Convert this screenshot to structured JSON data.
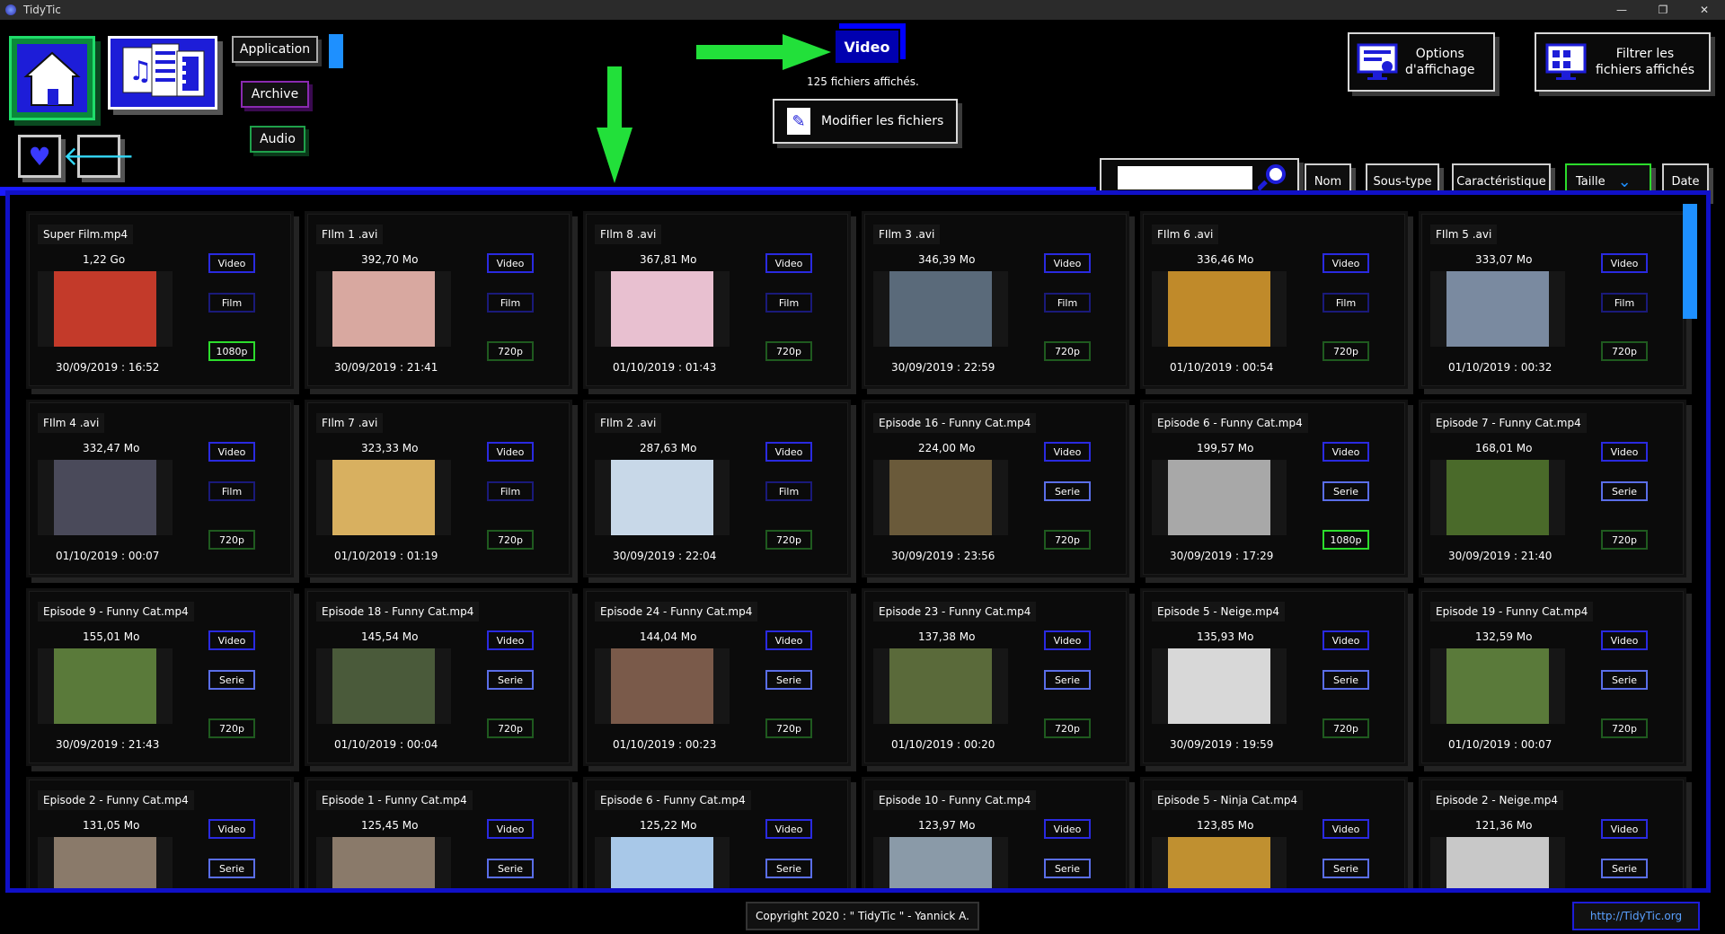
{
  "window": {
    "title": "TidyTic",
    "minimize": "—",
    "restore": "❐",
    "close": "✕"
  },
  "nav": {
    "application": "Application",
    "archive": "Archive",
    "audio": "Audio"
  },
  "header": {
    "category": "Video",
    "count_text": "125 fichiers affichés.",
    "modify_label": "Modifier les fichiers",
    "options_label_1": "Options",
    "options_label_2": "d'affichage",
    "filter_label_1": "Filtrer les",
    "filter_label_2": "fichiers affichés"
  },
  "search": {
    "value": "",
    "placeholder": ""
  },
  "sort": {
    "nom": "Nom",
    "soustype": "Sous-type",
    "caracteristique": "Caractéristique",
    "taille": "Taille",
    "date": "Date"
  },
  "files": [
    {
      "name": "Super Film.mp4",
      "size": "1,22 Go",
      "type": "Video",
      "sub": "Film",
      "res": "1080p",
      "date": "30/09/2019 : 16:52"
    },
    {
      "name": "FIlm 1 .avi",
      "size": "392,70 Mo",
      "type": "Video",
      "sub": "Film",
      "res": "720p",
      "date": "30/09/2019 : 21:41"
    },
    {
      "name": "FIlm 8 .avi",
      "size": "367,81 Mo",
      "type": "Video",
      "sub": "Film",
      "res": "720p",
      "date": "01/10/2019 : 01:43"
    },
    {
      "name": "FIlm 3 .avi",
      "size": "346,39 Mo",
      "type": "Video",
      "sub": "Film",
      "res": "720p",
      "date": "30/09/2019 : 22:59"
    },
    {
      "name": "FIlm 6 .avi",
      "size": "336,46 Mo",
      "type": "Video",
      "sub": "Film",
      "res": "720p",
      "date": "01/10/2019 : 00:54"
    },
    {
      "name": "FIlm 5 .avi",
      "size": "333,07 Mo",
      "type": "Video",
      "sub": "Film",
      "res": "720p",
      "date": "01/10/2019 : 00:32"
    },
    {
      "name": "FIlm 4 .avi",
      "size": "332,47 Mo",
      "type": "Video",
      "sub": "Film",
      "res": "720p",
      "date": "01/10/2019 : 00:07"
    },
    {
      "name": "FIlm 7 .avi",
      "size": "323,33 Mo",
      "type": "Video",
      "sub": "Film",
      "res": "720p",
      "date": "01/10/2019 : 01:19"
    },
    {
      "name": "FIlm 2 .avi",
      "size": "287,63 Mo",
      "type": "Video",
      "sub": "Film",
      "res": "720p",
      "date": "30/09/2019 : 22:04"
    },
    {
      "name": "Episode 16 - Funny Cat.mp4",
      "size": "224,00 Mo",
      "type": "Video",
      "sub": "Serie",
      "res": "720p",
      "date": "30/09/2019 : 23:56"
    },
    {
      "name": "Episode 6 - Funny Cat.mp4",
      "size": "199,57 Mo",
      "type": "Video",
      "sub": "Serie",
      "res": "1080p",
      "date": "30/09/2019 : 17:29"
    },
    {
      "name": "Episode 7 - Funny Cat.mp4",
      "size": "168,01 Mo",
      "type": "Video",
      "sub": "Serie",
      "res": "720p",
      "date": "30/09/2019 : 21:40"
    },
    {
      "name": "Episode 9 - Funny Cat.mp4",
      "size": "155,01 Mo",
      "type": "Video",
      "sub": "Serie",
      "res": "720p",
      "date": "30/09/2019 : 21:43"
    },
    {
      "name": "Episode 18 - Funny Cat.mp4",
      "size": "145,54 Mo",
      "type": "Video",
      "sub": "Serie",
      "res": "720p",
      "date": "01/10/2019 : 00:04"
    },
    {
      "name": "Episode 24 - Funny Cat.mp4",
      "size": "144,04 Mo",
      "type": "Video",
      "sub": "Serie",
      "res": "720p",
      "date": "01/10/2019 : 00:23"
    },
    {
      "name": "Episode 23 - Funny Cat.mp4",
      "size": "137,38 Mo",
      "type": "Video",
      "sub": "Serie",
      "res": "720p",
      "date": "01/10/2019 : 00:20"
    },
    {
      "name": "Episode 5 - Neige.mp4",
      "size": "135,93 Mo",
      "type": "Video",
      "sub": "Serie",
      "res": "720p",
      "date": "30/09/2019 : 19:59"
    },
    {
      "name": "Episode 19 - Funny Cat.mp4",
      "size": "132,59 Mo",
      "type": "Video",
      "sub": "Serie",
      "res": "720p",
      "date": "01/10/2019 : 00:07"
    },
    {
      "name": "Episode 2 - Funny Cat.mp4",
      "size": "131,05 Mo",
      "type": "Video",
      "sub": "Serie",
      "res": "",
      "date": ""
    },
    {
      "name": "Episode 1 - Funny Cat.mp4",
      "size": "125,45 Mo",
      "type": "Video",
      "sub": "Serie",
      "res": "",
      "date": ""
    },
    {
      "name": "Episode 6 - Funny Cat.mp4",
      "size": "125,22 Mo",
      "type": "Video",
      "sub": "Serie",
      "res": "",
      "date": ""
    },
    {
      "name": "Episode 10 - Funny Cat.mp4",
      "size": "123,97 Mo",
      "type": "Video",
      "sub": "Serie",
      "res": "",
      "date": ""
    },
    {
      "name": "Episode 5 - Ninja Cat.mp4",
      "size": "123,85 Mo",
      "type": "Video",
      "sub": "Serie",
      "res": "",
      "date": ""
    },
    {
      "name": "Episode 2 - Neige.mp4",
      "size": "121,36 Mo",
      "type": "Video",
      "sub": "Serie",
      "res": "",
      "date": ""
    }
  ],
  "footer": {
    "copyright": "Copyright 2020 : \" TidyTic \" - Yannick A.",
    "link": "http://TidyTic.org"
  },
  "colors": {
    "accent_blue": "#1a1aff",
    "accent_green": "#2cdc2c",
    "scroll": "#1e90ff"
  }
}
